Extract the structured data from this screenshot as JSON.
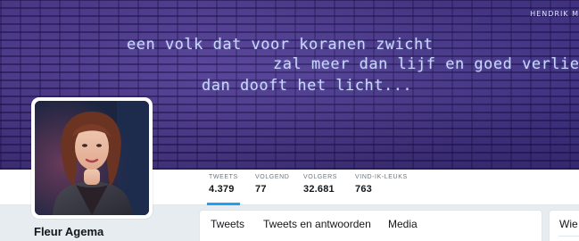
{
  "banner": {
    "poem_lines": [
      "een volk dat voor koranen zwicht",
      "zal meer dan lijf en goed verliezen",
      "dan dooft het licht..."
    ],
    "author": "HENDRIK M"
  },
  "profile": {
    "name": "Fleur Agema"
  },
  "stats": [
    {
      "label": "TWEETS",
      "value": "4.379"
    },
    {
      "label": "VOLGEND",
      "value": "77"
    },
    {
      "label": "VOLGERS",
      "value": "32.681"
    },
    {
      "label": "VIND-IK-LEUKS",
      "value": "763"
    }
  ],
  "timeline_tabs": [
    {
      "label": "Tweets"
    },
    {
      "label": "Tweets en antwoorden"
    },
    {
      "label": "Media"
    }
  ],
  "side_card": {
    "title": "Wie"
  },
  "colors": {
    "accent": "#1da1f2",
    "banner_base": "#4a3a86",
    "page_bg": "#e6ecf0"
  }
}
